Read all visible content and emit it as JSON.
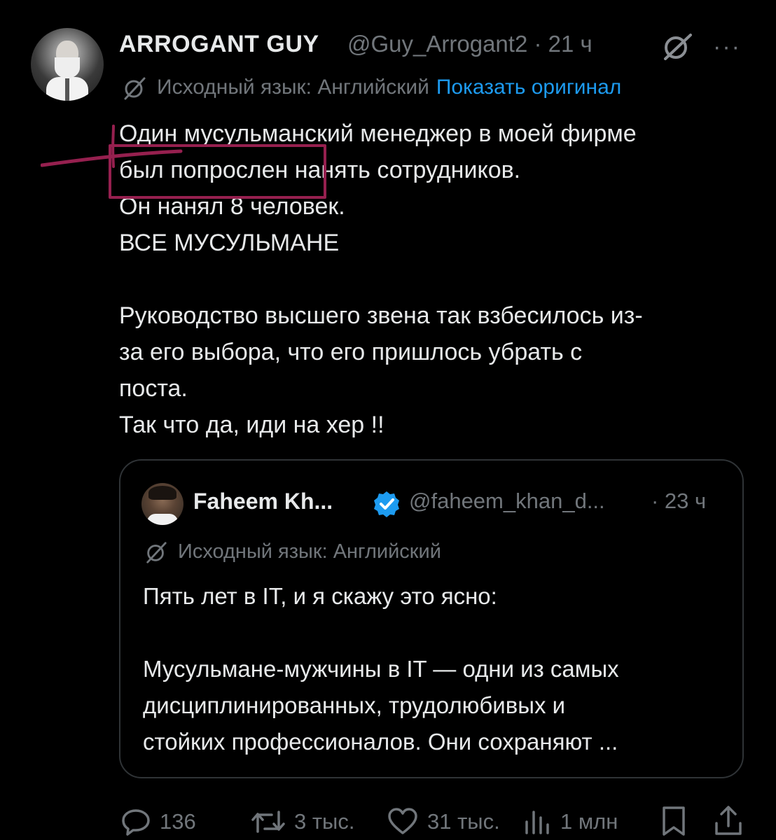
{
  "tweet": {
    "author_name": "ARROGANT GUY",
    "handle_time": "@Guy_Arrogant2 · 21 ч",
    "more_label": "···",
    "translation": {
      "label": "Исходный язык: Английский",
      "show_original": "Показать оригинал"
    },
    "body": "Один мусульманский менеджер в моей фирме\nбыл попрослен нанять сотрудников.\nОн нанял 8 человек.\nВСЕ МУСУЛЬМАНЕ\n\nРуководство высшего звена так взбесилось из-\nза его выбора, что его пришлось убрать с\nпоста.\nТак что да, иди на хер !!"
  },
  "quote": {
    "author_name": "Faheem Kh...",
    "handle": "@faheem_khan_d...",
    "time": "· 23 ч",
    "translation_label": "Исходный язык: Английский",
    "body": "Пять лет в IT, и я скажу это ясно:\n\nМусульмане-мужчины в IT — одни из самых\nдисциплинированных, трудолюбивых и\nстойких профессионалов. Они сохраняют ..."
  },
  "actions": {
    "replies": "136",
    "reposts": "3 тыс.",
    "likes": "31 тыс.",
    "views": "1 млн"
  },
  "colors": {
    "background": "#000000",
    "text": "#e7e9ea",
    "muted": "#71767b",
    "link": "#1d9bf0",
    "annotation": "#96204f",
    "verified": "#1d9bf0"
  }
}
